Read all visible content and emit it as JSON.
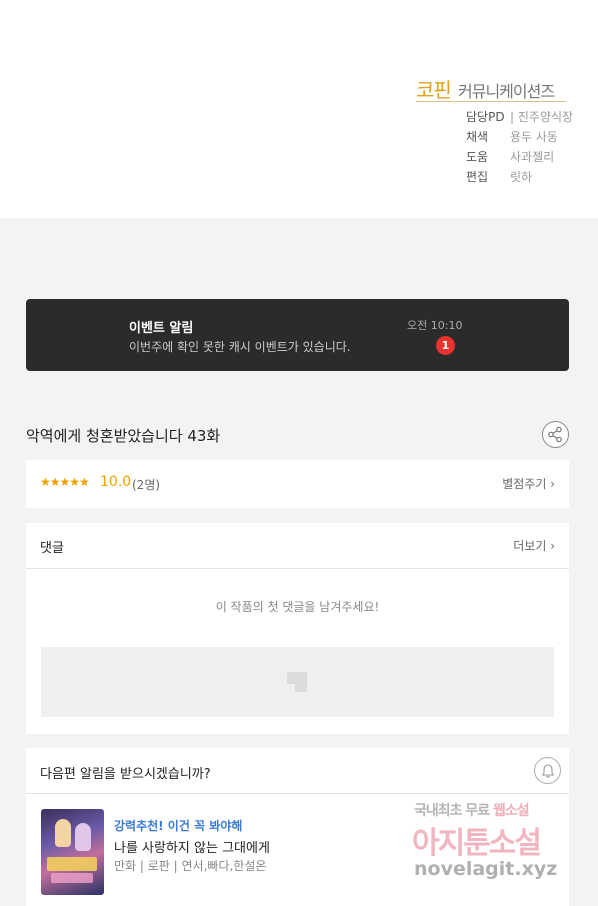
{
  "credits": {
    "brand_main": "코핀",
    "brand_sub": "커뮤니케이션즈",
    "rows": [
      {
        "role": "담당PD",
        "name": "| 진주양식장"
      },
      {
        "role": "채색",
        "name": "용두 사동"
      },
      {
        "role": "도움",
        "name": "사과젤리"
      },
      {
        "role": "편집",
        "name": "릿하"
      }
    ]
  },
  "event": {
    "title": "이벤트 알림",
    "description": "이번주에 확인 못한 캐시 이벤트가 있습니다.",
    "time": "오전 10:10",
    "badge": "1"
  },
  "episode": {
    "title": "악역에게 청혼받았습니다 43화"
  },
  "rating": {
    "stars": "★★★★★",
    "score": "10.0",
    "count": "(2명)",
    "rate_button": "별점주기 ›"
  },
  "comments": {
    "title": "댓글",
    "more_button": "더보기 ›",
    "empty_message": "이 작품의 첫 댓글을 남겨주세요!"
  },
  "alert": {
    "title": "다음편 알림을 받으시겠습니까?"
  },
  "recommendation": {
    "tag": "강력추천! 이건 꼭 봐야해",
    "title": "나를 사랑하지 않는 그대에게",
    "meta": "만화 | 로판 | 연서,빠다,한설온"
  },
  "watermark": {
    "line1_a": "국내최초 무료 ",
    "line1_b": "웹소설",
    "line2": "아지툰소설",
    "line3": "novelagit.xyz"
  }
}
